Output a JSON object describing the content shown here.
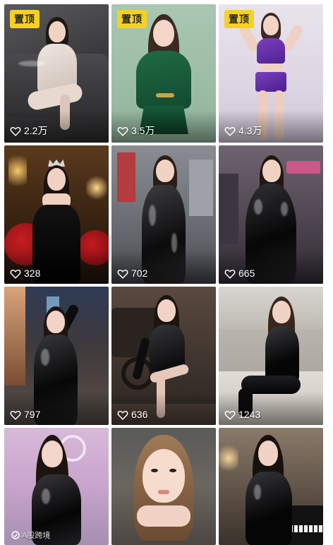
{
  "badge_label": "置顶",
  "watermark_text": "A股跨境",
  "colors": {
    "badge_bg": "#f5d21f",
    "like_text": "#ffffff"
  },
  "feed": {
    "items": [
      {
        "likes": "2.2万",
        "pinned": true,
        "scene": "beige-sofa"
      },
      {
        "likes": "3.5万",
        "pinned": true,
        "scene": "green-studio"
      },
      {
        "likes": "4.3万",
        "pinned": true,
        "scene": "purple-studio"
      },
      {
        "likes": "328",
        "pinned": false,
        "scene": "black-gown-roses"
      },
      {
        "likes": "702",
        "pinned": false,
        "scene": "latex-street"
      },
      {
        "likes": "665",
        "pinned": false,
        "scene": "latex-storefront"
      },
      {
        "likes": "797",
        "pinned": false,
        "scene": "latex-night-street"
      },
      {
        "likes": "636",
        "pinned": false,
        "scene": "latex-railway"
      },
      {
        "likes": "1243",
        "pinned": false,
        "scene": "latex-plaza"
      },
      {
        "likes": "",
        "pinned": false,
        "scene": "latex-neon-room"
      },
      {
        "likes": "",
        "pinned": false,
        "scene": "closeup-portrait"
      },
      {
        "likes": "",
        "pinned": false,
        "scene": "latex-piano"
      }
    ]
  },
  "icons": {
    "like": "heart-outline-icon",
    "watermark": "brand-logo-icon"
  }
}
